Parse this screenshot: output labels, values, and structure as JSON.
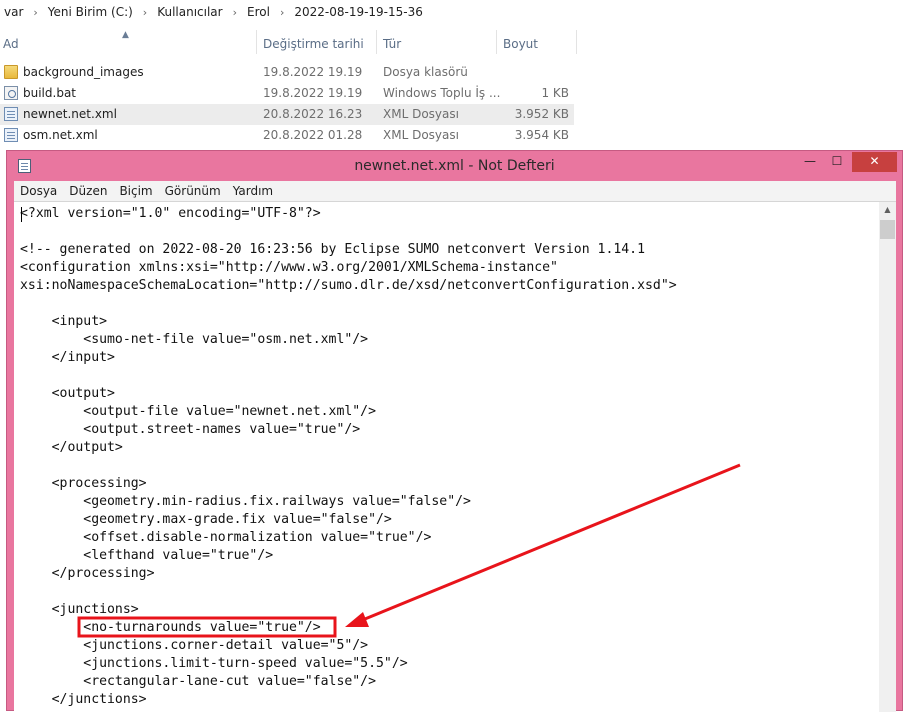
{
  "explorer": {
    "breadcrumb": [
      "var",
      "Yeni Birim (C:)",
      "Kullanıcılar",
      "Erol",
      "2022-08-19-19-15-36"
    ],
    "columns": {
      "name": "Ad",
      "date": "Değiştirme tarihi",
      "type": "Tür",
      "size": "Boyut"
    },
    "files": [
      {
        "name": "background_images",
        "date": "19.8.2022 19.19",
        "type": "Dosya klasörü",
        "size": "",
        "icon": "folder-icon",
        "selected": false
      },
      {
        "name": "build.bat",
        "date": "19.8.2022 19.19",
        "type": "Windows Toplu İş ...",
        "size": "1 KB",
        "icon": "batch-file-icon",
        "selected": false
      },
      {
        "name": "newnet.net.xml",
        "date": "20.8.2022 16.23",
        "type": "XML Dosyası",
        "size": "3.952 KB",
        "icon": "xml-file-icon",
        "selected": true
      },
      {
        "name": "osm.net.xml",
        "date": "20.8.2022 01.28",
        "type": "XML Dosyası",
        "size": "3.954 KB",
        "icon": "xml-file-icon",
        "selected": false
      }
    ]
  },
  "notepad": {
    "title": "newnet.net.xml - Not Defteri",
    "controls": {
      "minimize": "—",
      "maximize": "☐",
      "close": "✕"
    },
    "menu": [
      "Dosya",
      "Düzen",
      "Biçim",
      "Görünüm",
      "Yardım"
    ],
    "lines": [
      "<?xml version=\"1.0\" encoding=\"UTF-8\"?>",
      "",
      "<!-- generated on 2022-08-20 16:23:56 by Eclipse SUMO netconvert Version 1.14.1",
      "<configuration xmlns:xsi=\"http://www.w3.org/2001/XMLSchema-instance\"",
      "xsi:noNamespaceSchemaLocation=\"http://sumo.dlr.de/xsd/netconvertConfiguration.xsd\">",
      "",
      "    <input>",
      "        <sumo-net-file value=\"osm.net.xml\"/>",
      "    </input>",
      "",
      "    <output>",
      "        <output-file value=\"newnet.net.xml\"/>",
      "        <output.street-names value=\"true\"/>",
      "    </output>",
      "",
      "    <processing>",
      "        <geometry.min-radius.fix.railways value=\"false\"/>",
      "        <geometry.max-grade.fix value=\"false\"/>",
      "        <offset.disable-normalization value=\"true\"/>",
      "        <lefthand value=\"true\"/>",
      "    </processing>",
      "",
      "    <junctions>",
      "        <no-turnarounds value=\"true\"/>",
      "        <junctions.corner-detail value=\"5\"/>",
      "        <junctions.limit-turn-speed value=\"5.5\"/>",
      "        <rectangular-lane-cut value=\"false\"/>",
      "    </junctions>"
    ]
  },
  "annotation": {
    "color": "#e8141b"
  }
}
